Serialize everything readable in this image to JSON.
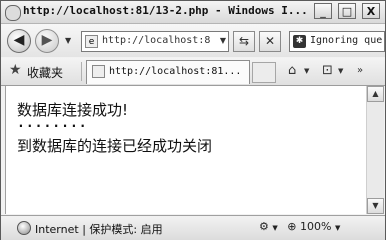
{
  "window": {
    "title": "http://localhost:81/13-2.php - Windows I...",
    "min_label": "_",
    "max_label": "□",
    "close_label": "X"
  },
  "nav": {
    "back_glyph": "◀",
    "forward_glyph": "▶",
    "address": "http://localhost:8",
    "search_text": "Ignoring que"
  },
  "favorites": {
    "label": "收藏夹",
    "tab_label": "http://localhost:81..."
  },
  "content": {
    "line1": "数据库连接成功!",
    "line2": "........",
    "line3": "到数据库的连接已经成功关闭"
  },
  "status": {
    "zone": "Internet",
    "protected_mode": "保护模式: 启用",
    "zoom": "100%"
  }
}
